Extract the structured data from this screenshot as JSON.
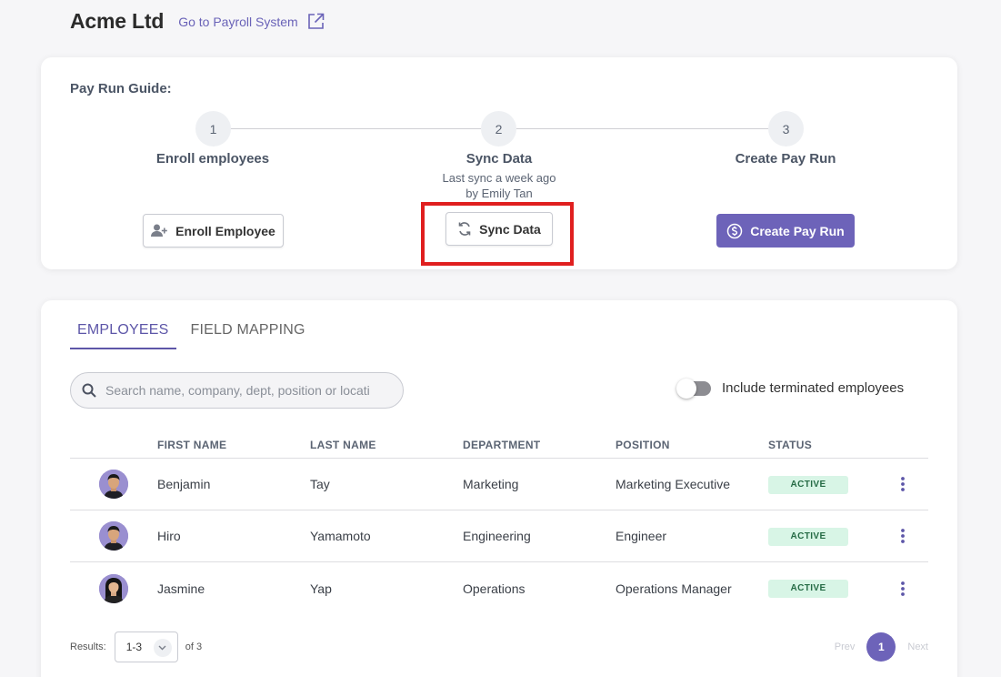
{
  "header": {
    "company_name": "Acme Ltd",
    "payroll_link": "Go to Payroll System"
  },
  "guide": {
    "title": "Pay Run Guide:",
    "steps": [
      {
        "number": "1",
        "label": "Enroll employees",
        "button": "Enroll Employee"
      },
      {
        "number": "2",
        "label": "Sync Data",
        "sub_line1": "Last sync a week ago",
        "sub_line2": "by Emily Tan",
        "button": "Sync Data"
      },
      {
        "number": "3",
        "label": "Create Pay Run",
        "button": "Create Pay Run"
      }
    ]
  },
  "tabs": [
    {
      "label": "EMPLOYEES",
      "active": true
    },
    {
      "label": "FIELD MAPPING",
      "active": false
    }
  ],
  "search": {
    "placeholder": "Search name, company, dept, position or location",
    "value": ""
  },
  "toggle": {
    "label": "Include terminated employees",
    "on": false
  },
  "table": {
    "columns": [
      "FIRST NAME",
      "LAST NAME",
      "DEPARTMENT",
      "POSITION",
      "STATUS"
    ],
    "rows": [
      {
        "first": "Benjamin",
        "last": "Tay",
        "department": "Marketing",
        "position": "Marketing Executive",
        "status": "ACTIVE"
      },
      {
        "first": "Hiro",
        "last": "Yamamoto",
        "department": "Engineering",
        "position": "Engineer",
        "status": "ACTIVE"
      },
      {
        "first": "Jasmine",
        "last": "Yap",
        "department": "Operations",
        "position": "Operations Manager",
        "status": "ACTIVE"
      }
    ]
  },
  "pagination": {
    "results_label": "Results:",
    "range": "1-3",
    "of_label": "of 3",
    "prev": "Prev",
    "current_page": "1",
    "next": "Next"
  },
  "colors": {
    "accent": "#6d63b9",
    "highlight": "#e01f1f",
    "active_badge_bg": "#d8f5e6"
  }
}
